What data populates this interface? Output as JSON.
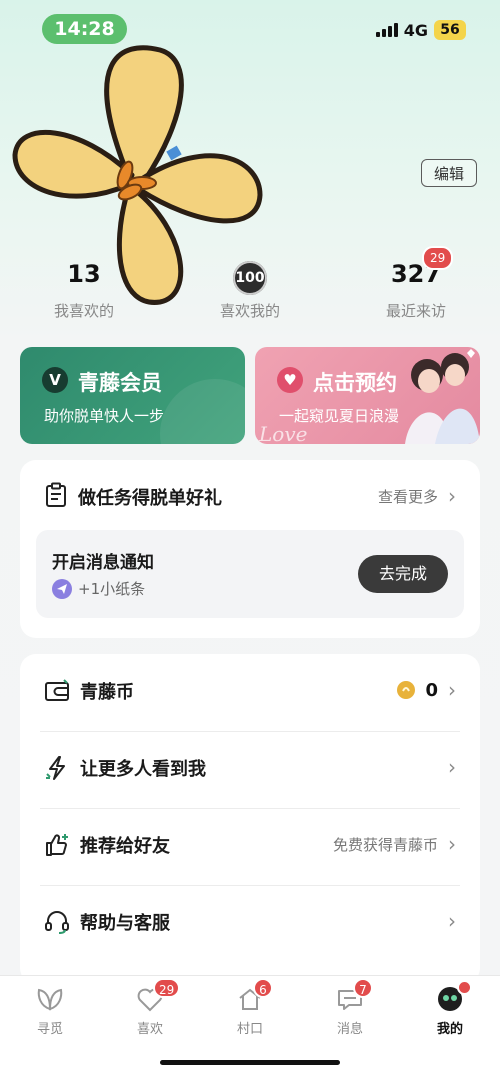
{
  "status_bar": {
    "time": "14:28",
    "network": "4G",
    "battery": "56"
  },
  "profile": {
    "edit_label": "编辑"
  },
  "stats": [
    {
      "value": "13",
      "label": "我喜欢的"
    },
    {
      "value": "100",
      "label": "喜欢我的"
    },
    {
      "value": "327",
      "label": "最近来访",
      "badge": "29"
    }
  ],
  "cards": {
    "vip": {
      "title": "青藤会员",
      "subtitle": "助你脱单快人一步",
      "logo": "V"
    },
    "booking": {
      "title": "点击预约",
      "subtitle": "一起窥见夏日浪漫",
      "decor_text": "Love"
    }
  },
  "tasks": {
    "title": "做任务得脱单好礼",
    "more_label": "查看更多",
    "item": {
      "title": "开启消息通知",
      "reward": "+1小纸条",
      "action_label": "去完成"
    }
  },
  "menu": [
    {
      "label": "青藤币",
      "icon": "wallet-icon",
      "value": "0"
    },
    {
      "label": "让更多人看到我",
      "icon": "boost-icon"
    },
    {
      "label": "推荐给好友",
      "icon": "thumbs-up-icon",
      "hint": "免费获得青藤币"
    },
    {
      "label": "帮助与客服",
      "icon": "headset-icon"
    }
  ],
  "tabbar": [
    {
      "label": "寻觅",
      "icon": "leaf-icon"
    },
    {
      "label": "喜欢",
      "icon": "heart-icon",
      "badge": "29"
    },
    {
      "label": "村口",
      "icon": "village-icon",
      "badge": "6"
    },
    {
      "label": "消息",
      "icon": "message-icon",
      "badge": "7"
    },
    {
      "label": "我的",
      "icon": "profile-icon",
      "active": true
    }
  ],
  "colors": {
    "accent_green": "#2f8a6d",
    "badge_red": "#e24c4c",
    "pink": "#e48aa0"
  }
}
